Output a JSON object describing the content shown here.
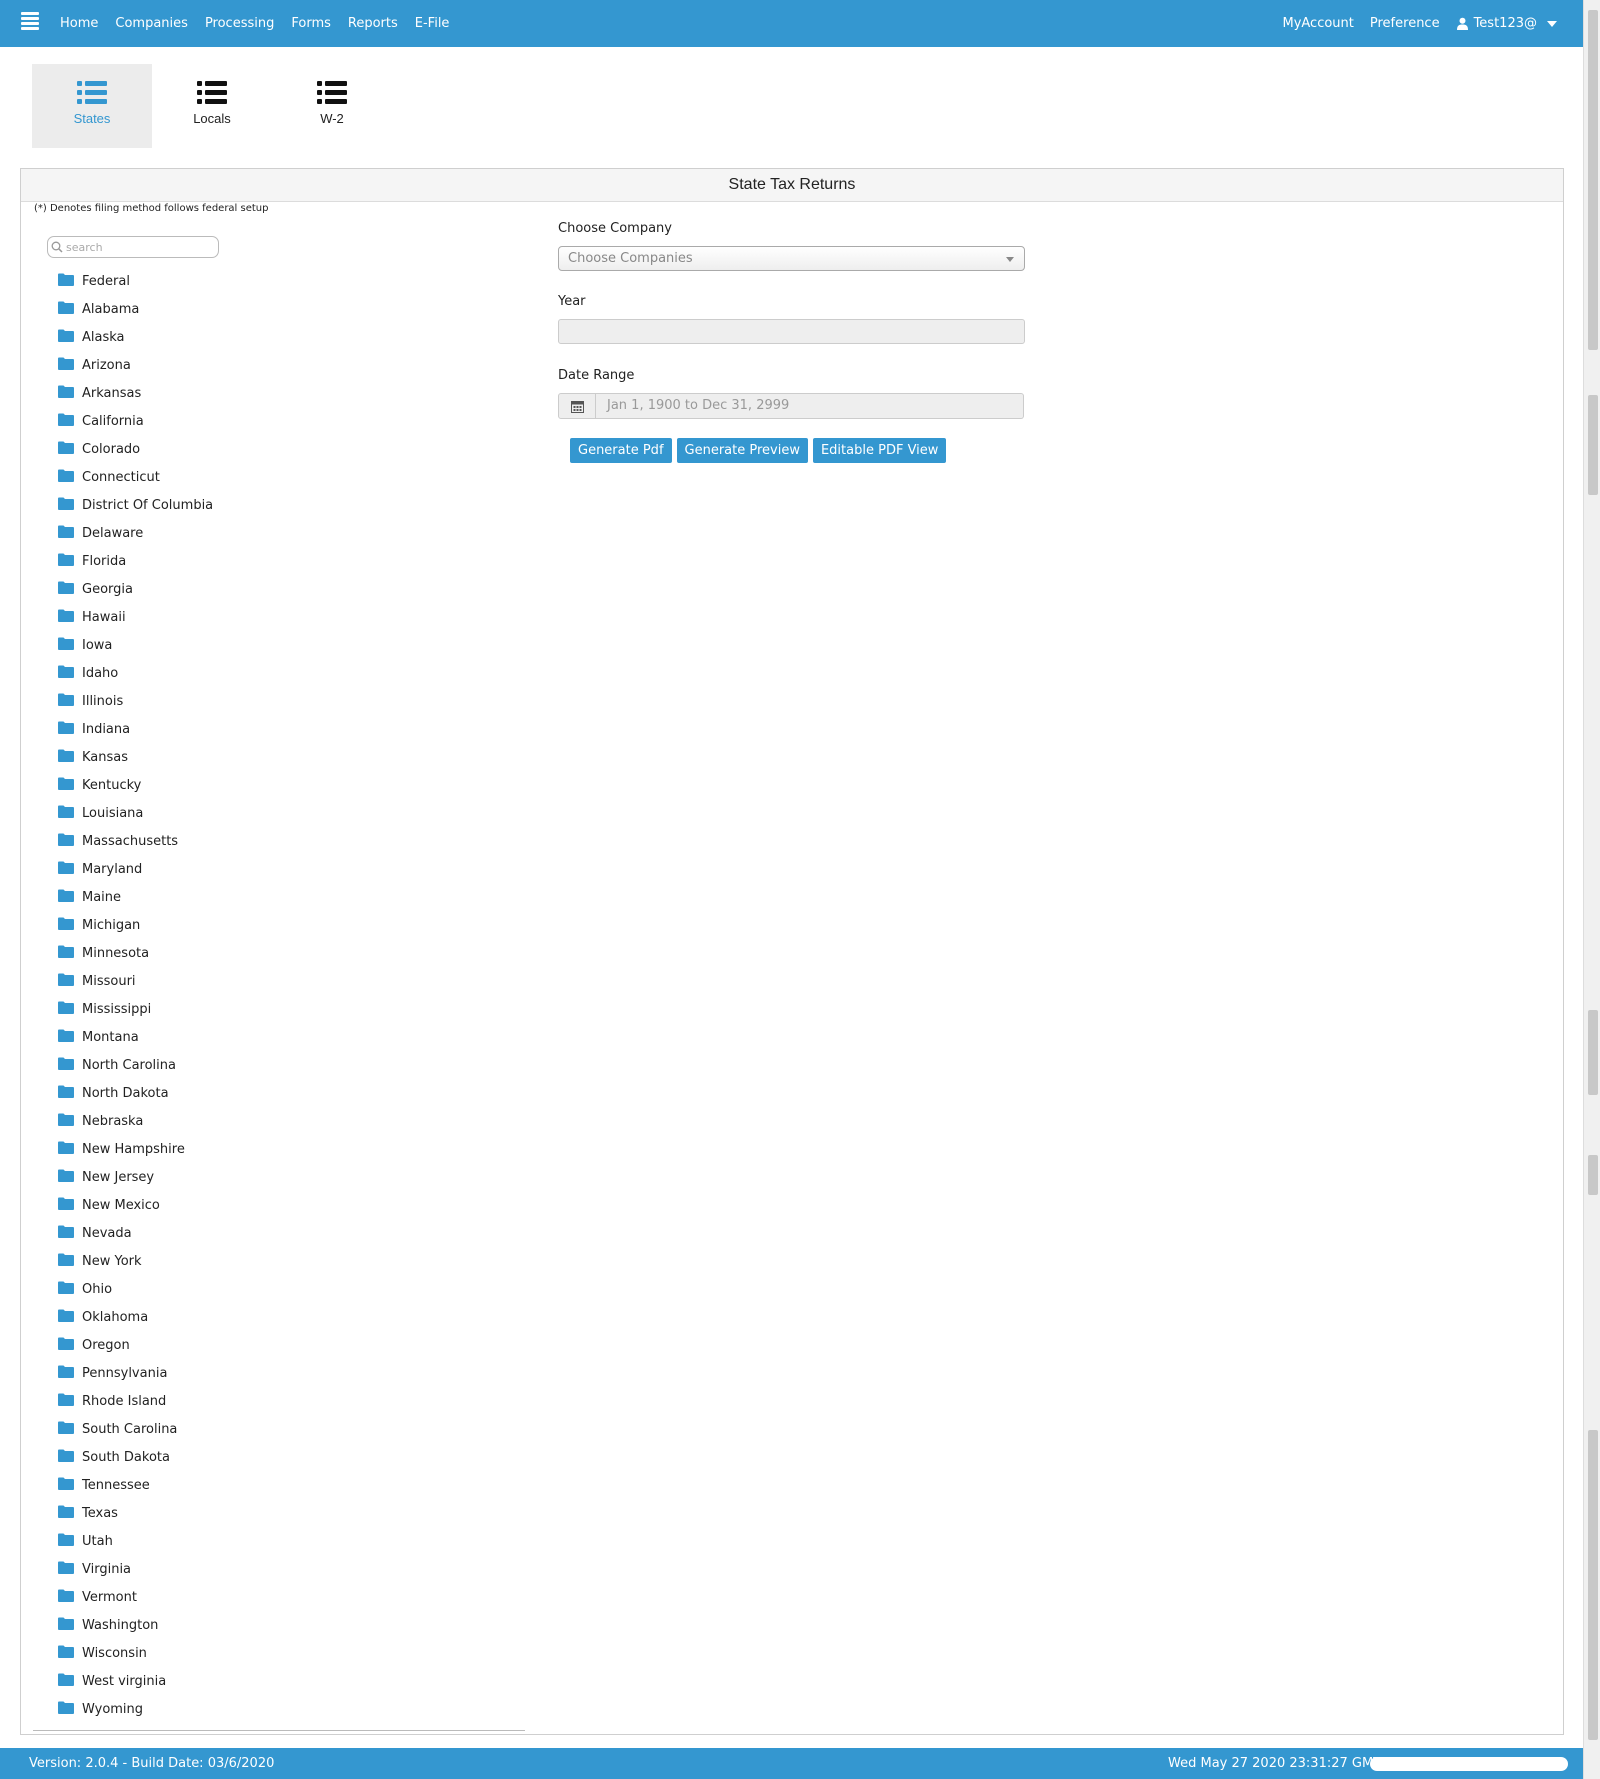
{
  "navbar": {
    "menu_icon": "hamburger-icon",
    "links": [
      "Home",
      "Companies",
      "Processing",
      "Forms",
      "Reports",
      "E-File"
    ],
    "my_account": "MyAccount",
    "preference": "Preference",
    "user": "Test123@",
    "bg_color": "#3497d0"
  },
  "tiles": [
    {
      "label": "States",
      "icon": "list-icon",
      "active": true
    },
    {
      "label": "Locals",
      "icon": "list-icon",
      "active": false
    },
    {
      "label": "W-2",
      "icon": "list-icon",
      "active": false
    }
  ],
  "panel": {
    "title": "State Tax Returns",
    "note": "(*) Denotes filing method follows federal setup",
    "search_placeholder": "search"
  },
  "tree_items": [
    "Federal",
    "Alabama",
    "Alaska",
    "Arizona",
    "Arkansas",
    "California",
    "Colorado",
    "Connecticut",
    "District Of Columbia",
    "Delaware",
    "Florida",
    "Georgia",
    "Hawaii",
    "Iowa",
    "Idaho",
    "Illinois",
    "Indiana",
    "Kansas",
    "Kentucky",
    "Louisiana",
    "Massachusetts",
    "Maryland",
    "Maine",
    "Michigan",
    "Minnesota",
    "Missouri",
    "Mississippi",
    "Montana",
    "North Carolina",
    "North Dakota",
    "Nebraska",
    "New Hampshire",
    "New Jersey",
    "New Mexico",
    "Nevada",
    "New York",
    "Ohio",
    "Oklahoma",
    "Oregon",
    "Pennsylvania",
    "Rhode Island",
    "South Carolina",
    "South Dakota",
    "Tennessee",
    "Texas",
    "Utah",
    "Virginia",
    "Vermont",
    "Washington",
    "Wisconsin",
    "West virginia",
    "Wyoming"
  ],
  "form": {
    "company_label": "Choose Company",
    "company_placeholder": "Choose Companies",
    "year_label": "Year",
    "year_value": "",
    "date_range_label": "Date Range",
    "date_range_value": "Jan 1, 1900 to Dec 31, 2999",
    "buttons": [
      "Generate Pdf",
      "Generate Preview",
      "Editable PDF View"
    ]
  },
  "footer": {
    "version": "Version: 2.0.4 - Build Date: 03/6/2020",
    "timestamp": "Wed May 27 2020 23:31:27 GMT"
  }
}
